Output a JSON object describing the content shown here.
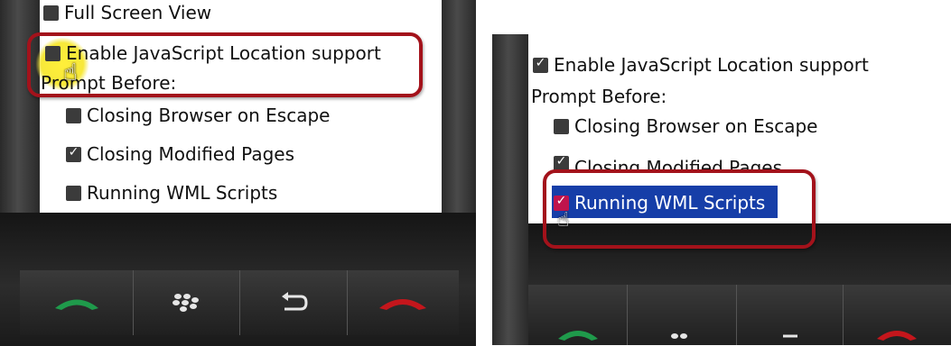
{
  "left_panel": {
    "options": [
      {
        "label": "Full Screen View",
        "checked": false
      },
      {
        "label": "Enable JavaScript Location support",
        "checked": false
      },
      {
        "label": "Prompt Before:"
      },
      {
        "label": "Closing Browser on Escape",
        "checked": false
      },
      {
        "label": "Closing Modified Pages",
        "checked": true
      },
      {
        "label": "Running WML Scripts",
        "checked": false
      }
    ]
  },
  "right_panel": {
    "options": [
      {
        "label": "Enable JavaScript Location support",
        "checked": true
      },
      {
        "label": "Prompt Before:"
      },
      {
        "label": "Closing Browser on Escape",
        "checked": false
      },
      {
        "label": "Closing Modified Pages",
        "checked": true
      },
      {
        "label": "Running WML Scripts",
        "checked": true
      }
    ]
  },
  "keys": {
    "call": "call-icon",
    "menu": "blackberry-menu-icon",
    "back": "back-arrow-icon",
    "end": "end-call-icon"
  },
  "colors": {
    "highlight_ring": "#a3121b",
    "selection": "#163ea8",
    "call_green": "#1f9a4b",
    "end_red": "#c4161c"
  }
}
